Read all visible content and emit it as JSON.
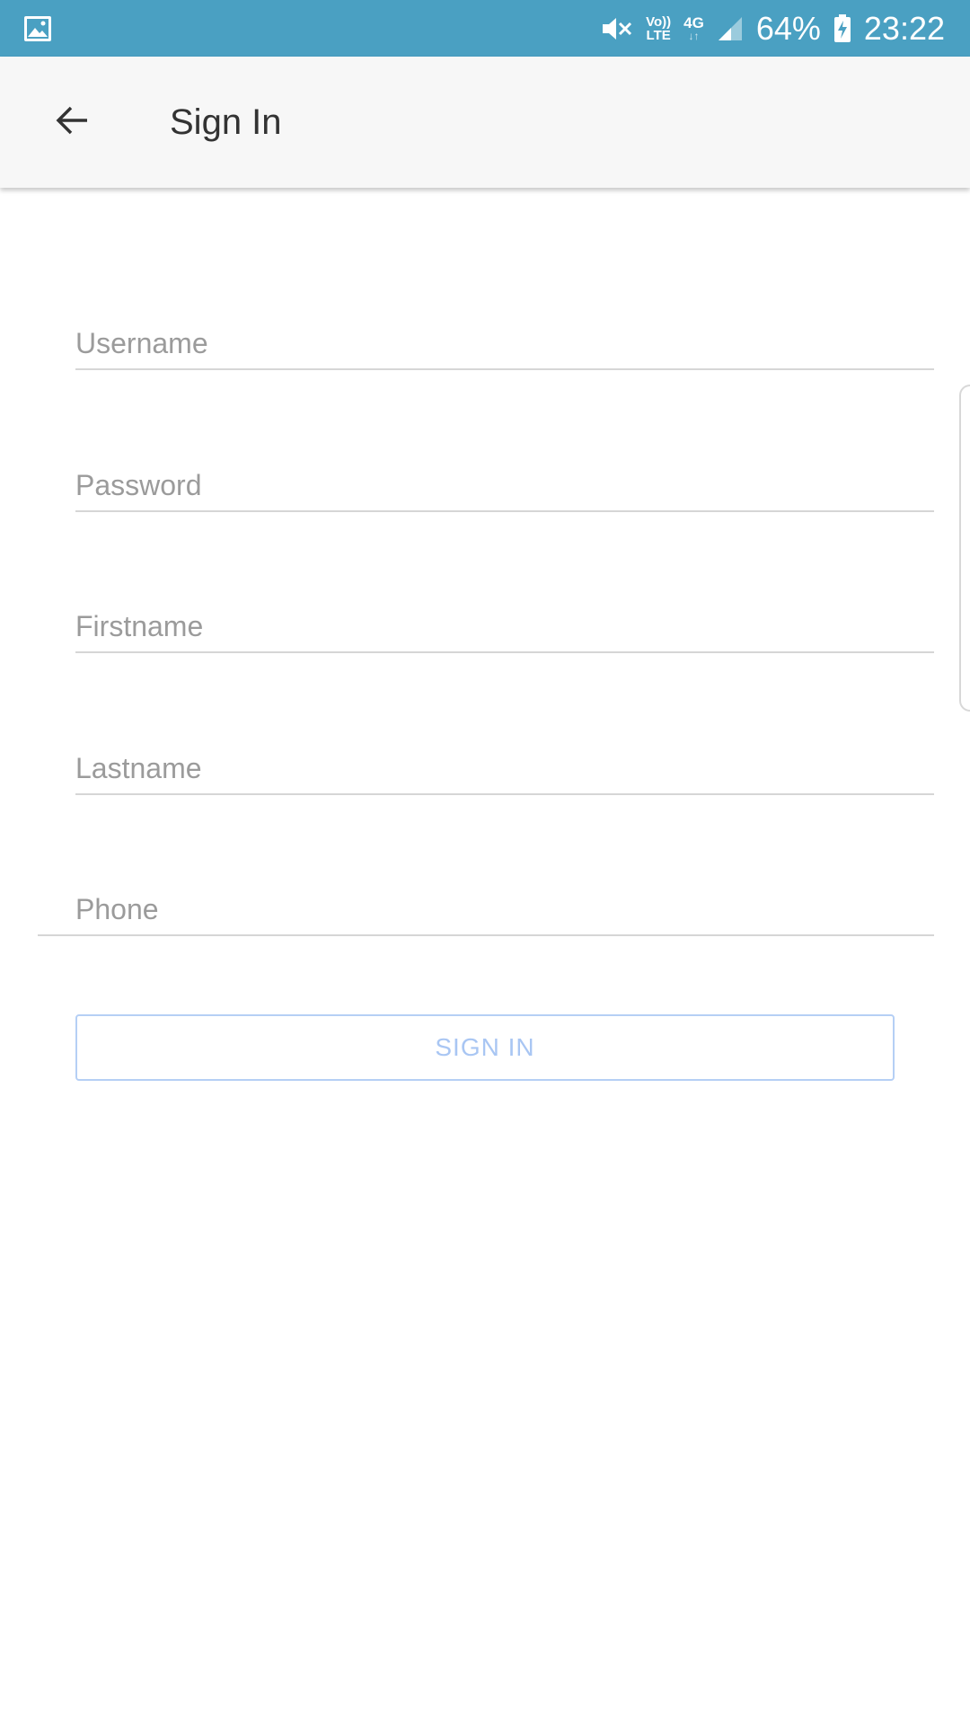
{
  "status_bar": {
    "battery": "64%",
    "time": "23:22",
    "volte_top": "Vo))",
    "volte_bottom": "LTE",
    "network": "4G",
    "network_arrows": "↓↑",
    "background_color": "#4aa0c2"
  },
  "app_bar": {
    "title": "Sign In",
    "back_icon": "arrow-back-icon"
  },
  "form": {
    "username_placeholder": "Username",
    "password_placeholder": "Password",
    "firstname_placeholder": "Firstname",
    "lastname_placeholder": "Lastname",
    "phone_placeholder": "Phone",
    "submit_label": "SIGN IN"
  },
  "colors": {
    "button_border": "#b5cff5",
    "button_text": "#a9c6f3",
    "placeholder": "#9b9b9b",
    "title": "#333333"
  }
}
